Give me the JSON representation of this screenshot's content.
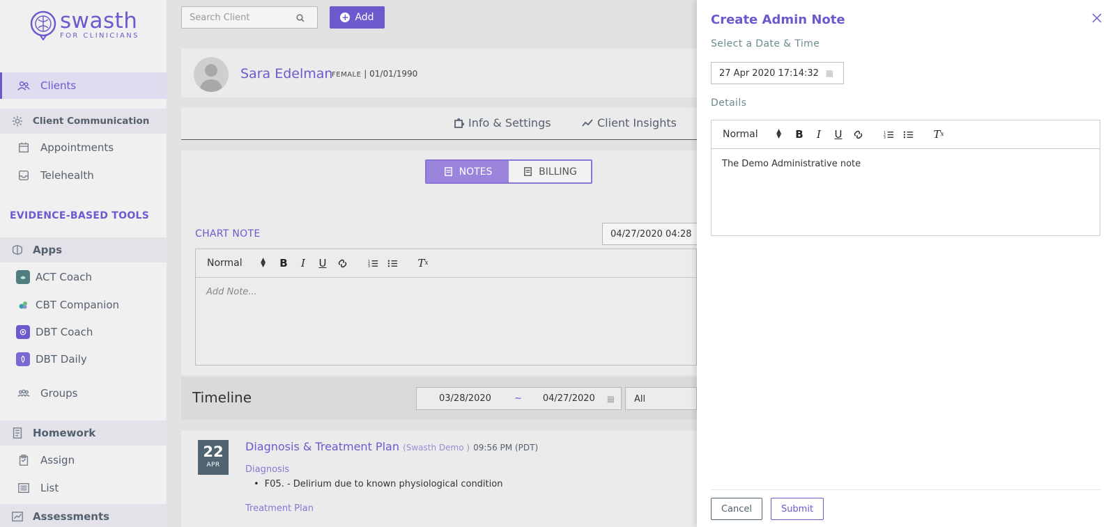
{
  "brand": {
    "name": "swasth",
    "tagline": "FOR CLINICIANS"
  },
  "sidebar": {
    "items": [
      {
        "label": "Clients",
        "icon": "users-icon"
      },
      {
        "label": "Client Communication",
        "icon": "gear-icon"
      },
      {
        "label": "Appointments",
        "icon": "calendar-icon"
      },
      {
        "label": "Telehealth",
        "icon": "inbox-icon"
      }
    ],
    "section_tools": "EVIDENCE-BASED TOOLS",
    "apps_group": "Apps",
    "apps": [
      {
        "label": "ACT Coach",
        "icon": "act-coach-icon"
      },
      {
        "label": "CBT Companion",
        "icon": "cbt-companion-icon"
      },
      {
        "label": "DBT Coach",
        "icon": "dbt-coach-icon"
      },
      {
        "label": "DBT Daily",
        "icon": "dbt-daily-icon"
      }
    ],
    "groups": "Groups",
    "homework": "Homework",
    "assign": "Assign",
    "list": "List",
    "assessments": "Assessments"
  },
  "topbar": {
    "search_placeholder": "Search Client",
    "add_label": "Add"
  },
  "client": {
    "name": "Sara Edelman",
    "sex": "FEMALE",
    "dob": "01/01/1990"
  },
  "tabs": {
    "info": "Info & Settings",
    "insights": "Client Insights"
  },
  "segment": {
    "notes": "NOTES",
    "billing": "BILLING"
  },
  "chart_note": {
    "label": "CHART NOTE",
    "date": "04/27/2020 04:28",
    "placeholder": "Add Note..."
  },
  "toolbar": {
    "format": "Normal"
  },
  "timeline": {
    "title": "Timeline",
    "from": "03/28/2020",
    "sep": "~",
    "to": "04/27/2020",
    "filter": "All",
    "entry": {
      "day": "22",
      "month": "APR",
      "title": "Diagnosis & Treatment Plan",
      "author": "(Swasth Demo )",
      "time": "09:56 PM (PDT)",
      "diagnosis_head": "Diagnosis",
      "diagnosis_item": "F05. - Delirium due to known physiological condition",
      "treatment_head": "Treatment Plan"
    }
  },
  "drawer": {
    "title": "Create Admin Note",
    "date_label": "Select a Date & Time",
    "date_value": "27 Apr 2020 17:14:32",
    "details_label": "Details",
    "format": "Normal",
    "body": "The Demo Administrative note",
    "cancel": "Cancel",
    "submit": "Submit"
  },
  "colors": {
    "accent": "#6a5acd",
    "badge": "#4f6470",
    "muted": "#6a8a8e"
  }
}
